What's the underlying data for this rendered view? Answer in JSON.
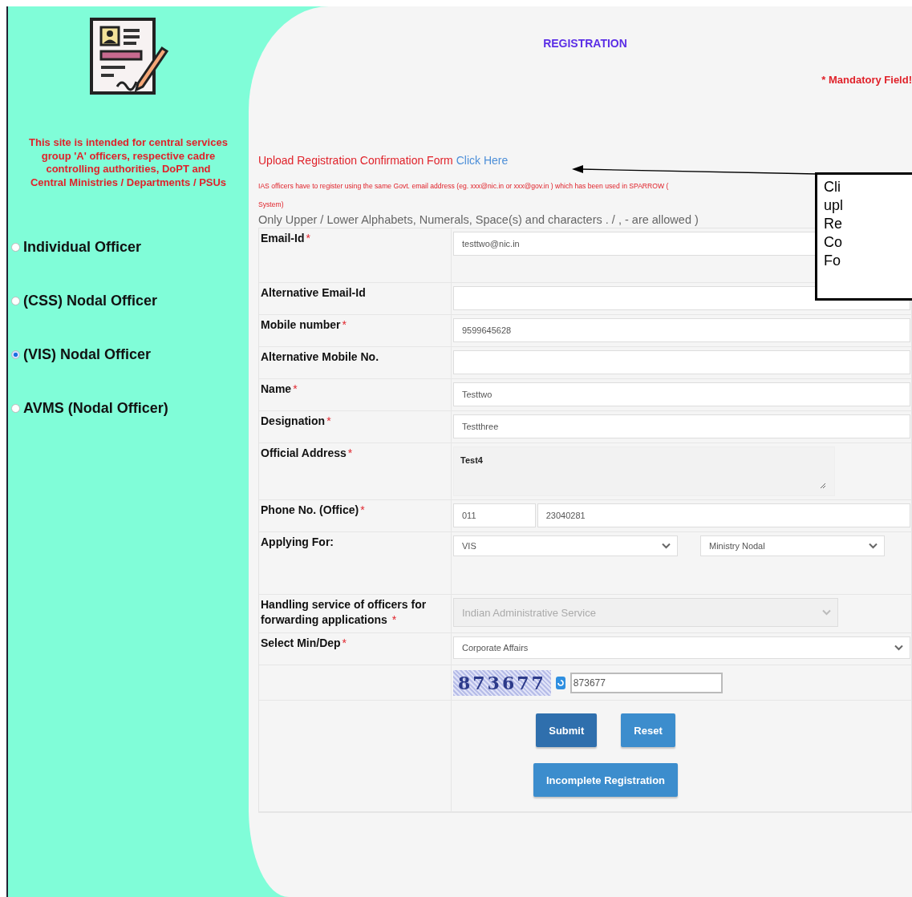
{
  "sidebar": {
    "notice": "This site is intended for central services group 'A' officers, respective cadre controlling authorities, DoPT and Central Ministries / Departments / PSUs",
    "roles": [
      {
        "label": "Individual Officer",
        "selected": false
      },
      {
        "label": "(CSS) Nodal Officer",
        "selected": false
      },
      {
        "label": "(VIS) Nodal Officer",
        "selected": true
      },
      {
        "label": "AVMS (Nodal Officer)",
        "selected": false
      }
    ]
  },
  "form": {
    "title": "REGISTRATION",
    "mandatory_note": "* Mandatory Field!",
    "upload": {
      "text": "Upload Registration Confirmation Form",
      "link": "Click Here"
    },
    "ias_note": "IAS officers have to register using the same Govt. email address (eg. xxx@nic.in or xxx@gov.in ) which has been used in SPARROW (",
    "ias_note_cont": "System)",
    "allowed_note": "Only Upper / Lower Alphabets, Numerals, Space(s) and characters . / , - are allowed )",
    "fields": [
      {
        "kind": "input",
        "label": "Email-Id",
        "required_mark": "*",
        "value": "testtwo@nic.in"
      },
      {
        "kind": "input",
        "label": "Alternative Email-Id"
      },
      {
        "kind": "input",
        "label": "Mobile number",
        "required_mark": "*",
        "value": "9599645628"
      },
      {
        "kind": "input",
        "label": "Alternative Mobile No."
      },
      {
        "kind": "input",
        "label": "Name",
        "required_mark": "*",
        "value": "Testtwo"
      },
      {
        "kind": "input",
        "label": "Designation",
        "required_mark": "*",
        "value": "Testthree"
      },
      {
        "kind": "textarea",
        "label": "Official Address",
        "required_mark": "*",
        "value": "Test4"
      },
      {
        "kind": "phone",
        "label": "Phone No. (Office)",
        "required_mark": "*",
        "values": [
          "011",
          "23040281"
        ]
      },
      {
        "kind": "selects",
        "label": "Applying For:",
        "values": [
          "VIS",
          "Ministry Nodal"
        ]
      },
      {
        "kind": "select",
        "label": "Handling service of officers for forwarding applications ",
        "required_mark": "*",
        "value": "Indian Administrative Service",
        "disabled": true
      },
      {
        "kind": "select",
        "label": "Select Min/Dep",
        "required_mark": "*",
        "value": "Corporate Affairs",
        "disabled": false
      }
    ],
    "captcha": {
      "code": "873677",
      "value": "873677"
    },
    "buttons": [
      {
        "label": "Submit",
        "selected": true
      },
      {
        "label": "Reset",
        "selected": false
      }
    ],
    "incomplete_button": "Incomplete Registration"
  },
  "callout": {
    "lines": [
      "Cli",
      "upl",
      "Re",
      "Co",
      "Fo"
    ]
  }
}
